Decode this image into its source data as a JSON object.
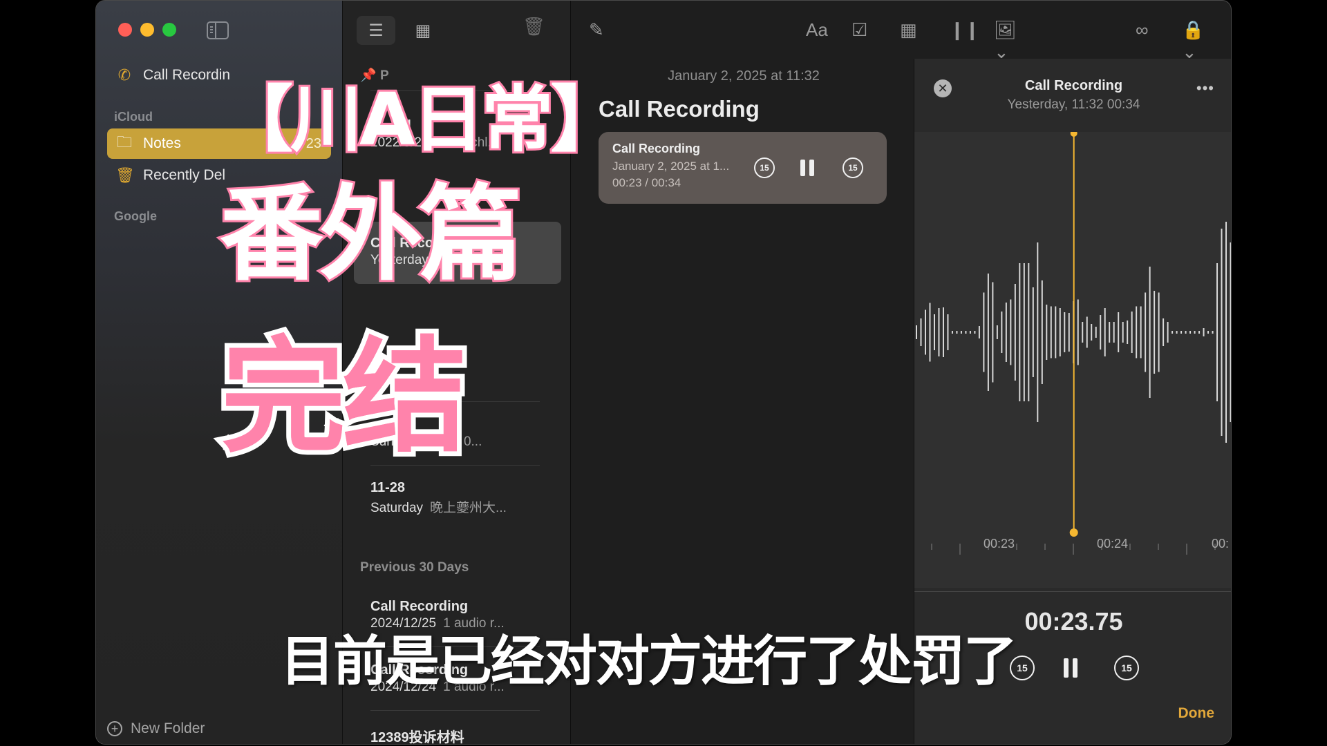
{
  "window": {
    "traffic_lights": [
      "close",
      "minimize",
      "zoom"
    ]
  },
  "sidebar": {
    "top_item": {
      "label": "Call Recordin",
      "icon": "phone-waveform-icon"
    },
    "sections": [
      {
        "label": "iCloud"
      },
      {
        "label": "Google"
      }
    ],
    "items": [
      {
        "label": "Notes",
        "count": "23",
        "icon": "folder-icon",
        "active": true
      },
      {
        "label": "Recently Del",
        "icon": "trash-icon",
        "active": false
      }
    ],
    "new_folder_label": "New Folder"
  },
  "note_list": {
    "pinned_label": "P",
    "sections": [
      {
        "label": "Previous 30 Days"
      }
    ],
    "notes": [
      {
        "title": "W... El",
        "date": "2022/9/20",
        "preview": "Nordschl..."
      },
      {
        "title": "Call Recording",
        "date": "Yesterday",
        "preview": "1"
      },
      {
        "title": "",
        "date": "",
        "preview": "..."
      },
      {
        "title": "",
        "date": "Sunda",
        "preview": "0..."
      },
      {
        "title": "11-28",
        "date": "Saturday",
        "preview": "晚上夔州大..."
      },
      {
        "title": "Call Recording",
        "date": "2024/12/25",
        "preview": "1 audio r..."
      },
      {
        "title": "Call Recording",
        "date": "2024/12/24",
        "preview": "1 audio r..."
      },
      {
        "title": "12389投诉材料",
        "date": "",
        "preview": ""
      }
    ]
  },
  "toolbar": {
    "icons": [
      "list-view-icon",
      "gallery-view-icon",
      "trash-icon",
      "compose-icon",
      "format-icon",
      "checklist-icon",
      "table-icon",
      "audio-icon",
      "media-icon",
      "collaborate-icon",
      "lock-icon",
      "share-icon",
      "search-icon"
    ],
    "format_label": "Aa"
  },
  "editor": {
    "date": "January 2, 2025 at 11:32",
    "title": "Call Recording",
    "player": {
      "title": "Call Recording",
      "subtitle": "January 2, 2025 at 1...",
      "time": "00:23 / 00:34",
      "skip_back": "15",
      "skip_forward": "15"
    }
  },
  "recording_panel": {
    "title": "Call Recording",
    "subtitle": "Yesterday, 11:32   00:34",
    "more_label": "•••",
    "timeline_labels": [
      "00:23",
      "00:24",
      "00:"
    ],
    "elapsed": "00:23.75",
    "skip_back": "15",
    "skip_forward": "15",
    "done_label": "Done",
    "playhead_progress": 0.7,
    "accent_color": "#f5b731"
  },
  "overlay": {
    "title_line1": "【川A日常】",
    "title_line2": "番外篇",
    "title_line3": "完结",
    "subtitle": "目前是已经对对方进行了处罚了"
  },
  "colors": {
    "folder_active": "#c8a23a",
    "done": "#e3a83a",
    "caption_pink": "#ff83ab"
  }
}
